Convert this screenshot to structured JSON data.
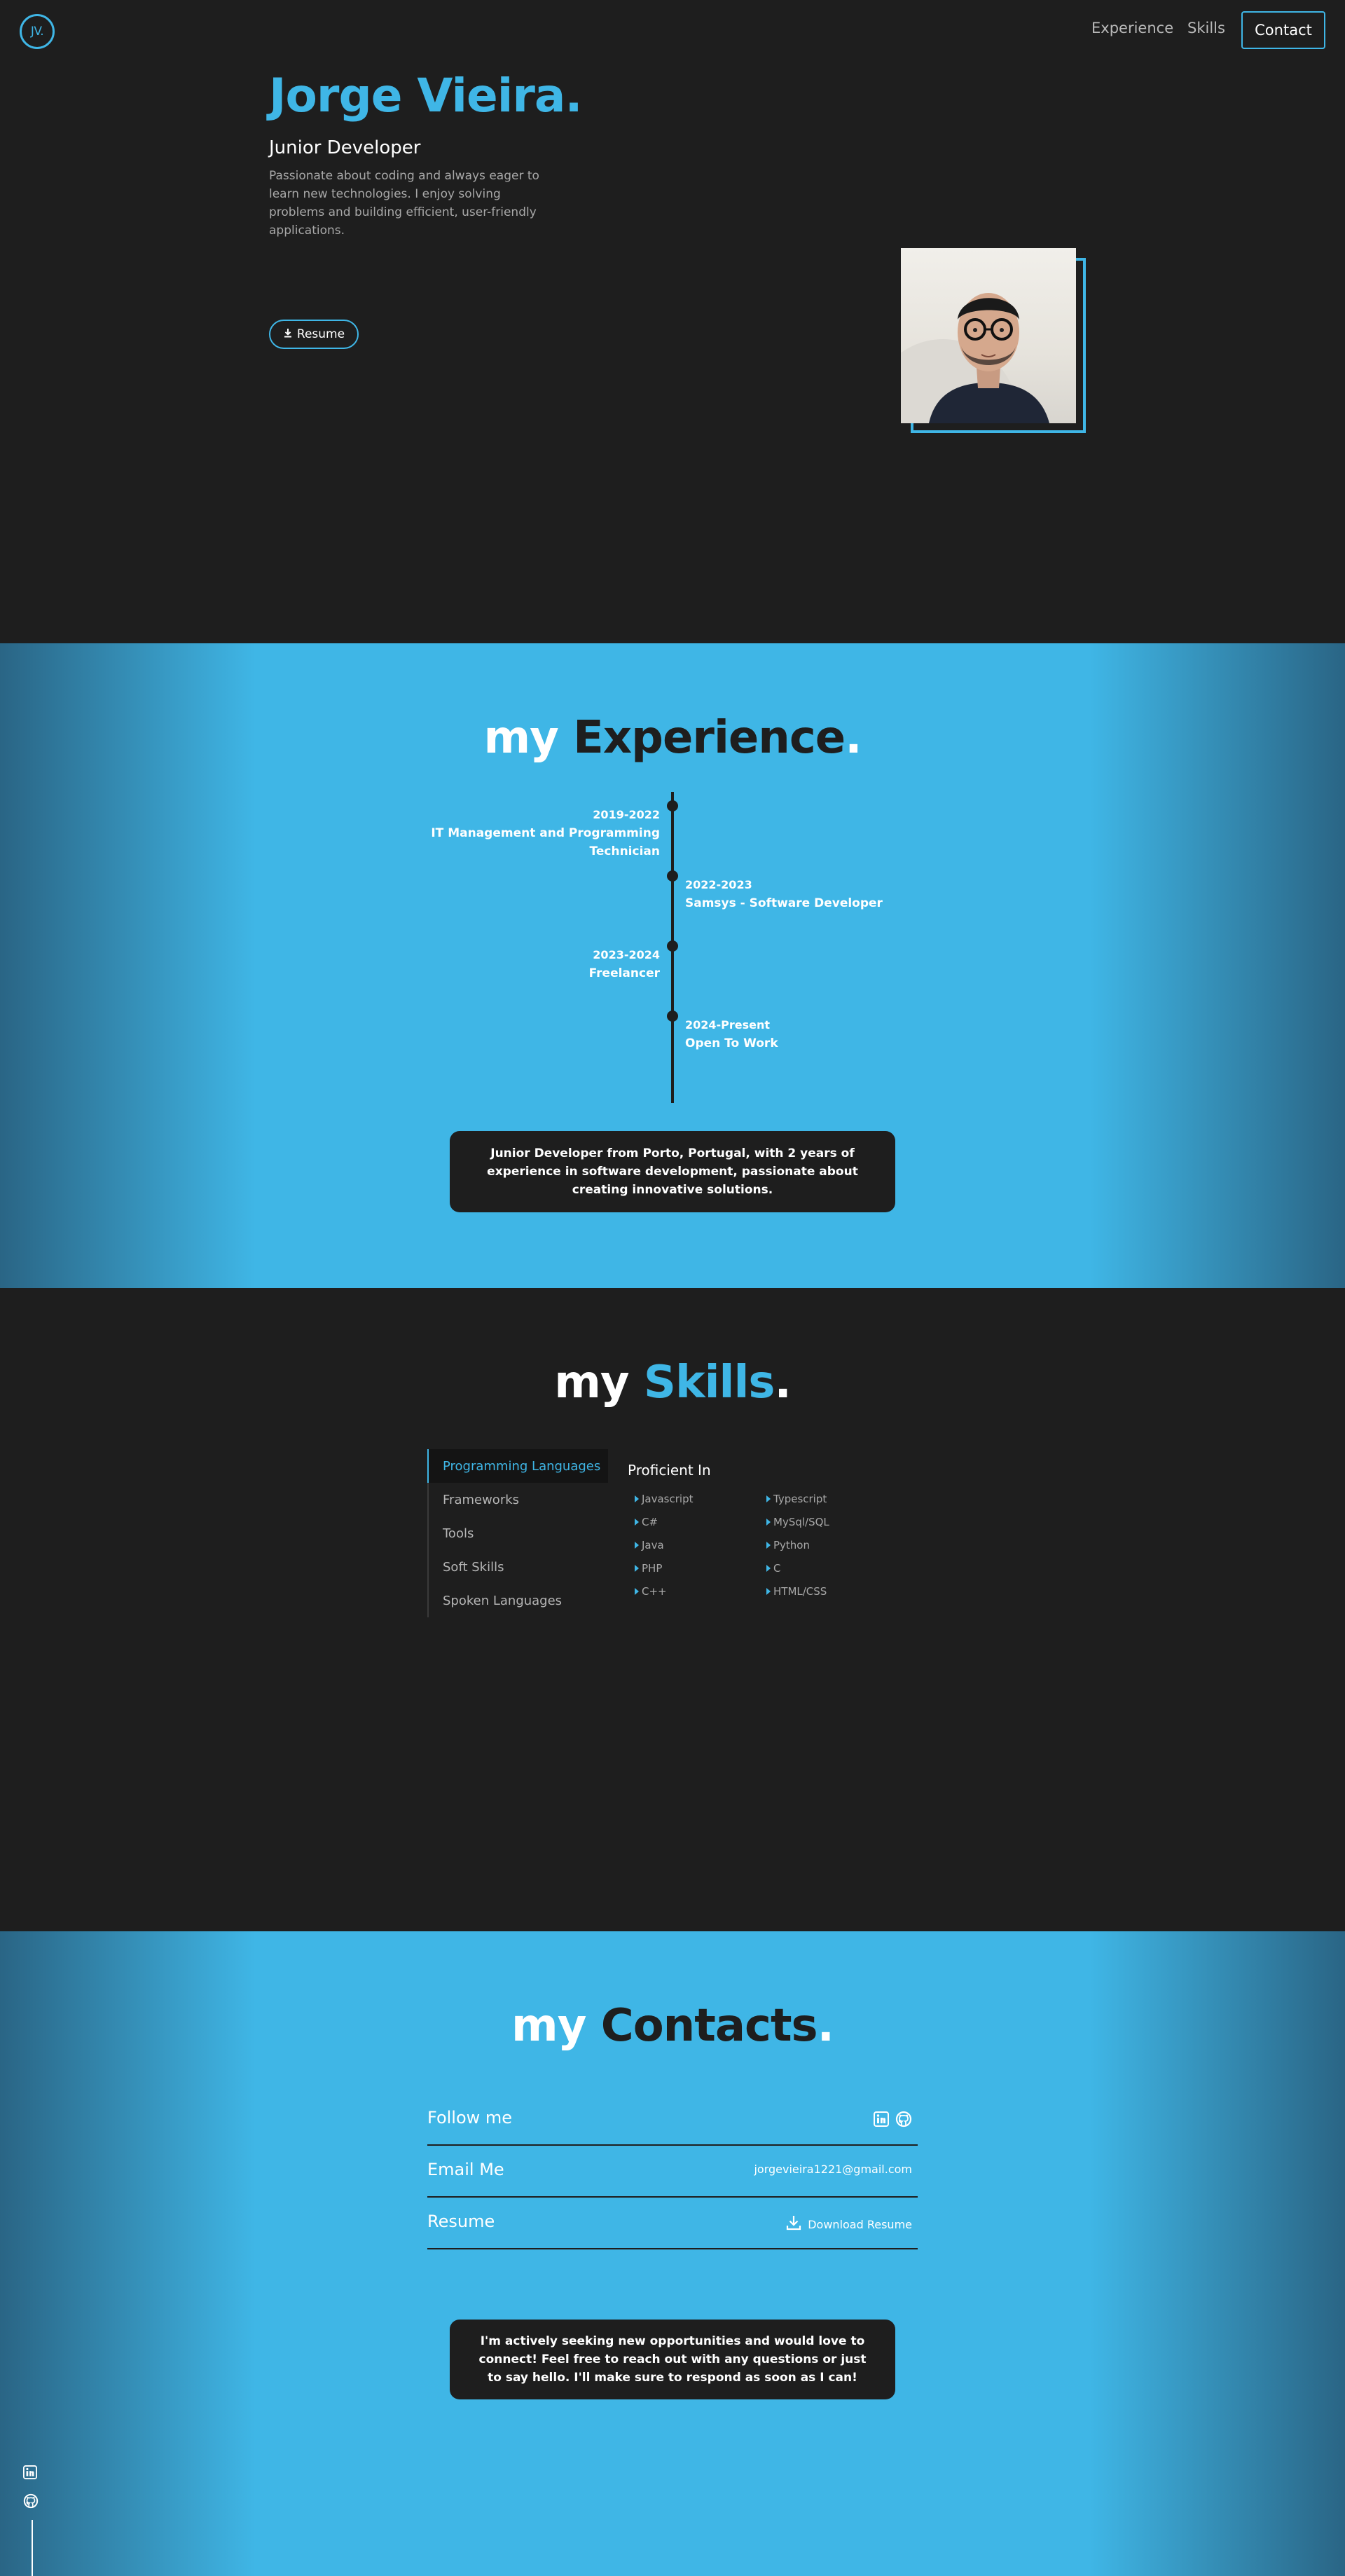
{
  "nav": {
    "logo": "JV.",
    "links": [
      "Experience",
      "Skills"
    ],
    "contact_label": "Contact"
  },
  "hero": {
    "name": "Jorge Vieira.",
    "role": "Junior Developer",
    "description": "Passionate about coding and always eager to learn new technologies. I enjoy solving problems and building efficient, user-friendly applications.",
    "resume_label": "Resume"
  },
  "experience": {
    "title_prefix": "my ",
    "title_word": "Experience",
    "title_dot": ".",
    "items": [
      {
        "date": "2019-2022",
        "title": "IT Management and Programming Technician",
        "side": "left"
      },
      {
        "date": "2022-2023",
        "title": "Samsys - Software Developer",
        "side": "right"
      },
      {
        "date": "2023-2024",
        "title": "Freelancer",
        "side": "left"
      },
      {
        "date": "2024-Present",
        "title": "Open To Work",
        "side": "right"
      }
    ],
    "summary": "Junior Developer from Porto, Portugal, with 2 years of experience in software development, passionate about creating innovative solutions."
  },
  "skills": {
    "title_prefix": "my ",
    "title_word": "Skills",
    "title_dot": ".",
    "tabs": [
      "Programming Languages",
      "Frameworks",
      "Tools",
      "Soft Skills",
      "Spoken Languages"
    ],
    "active_tab": "Programming Languages",
    "heading": "Proficient In",
    "items": [
      "Javascript",
      "Typescript",
      "C#",
      "MySql/SQL",
      "Java",
      "Python",
      "PHP",
      "C",
      "C++",
      "HTML/CSS"
    ]
  },
  "contacts": {
    "title_prefix": "my ",
    "title_word": "Contacts",
    "title_dot": ".",
    "rows": [
      {
        "label": "Follow me",
        "value": ""
      },
      {
        "label": "Email Me",
        "value": "jorgevieira1221@gmail.com"
      },
      {
        "label": "Resume",
        "value": "Download Resume"
      }
    ],
    "message": "I'm actively seeking new opportunities and would love to connect! Feel free to reach out with any questions or just to say hello. I'll make sure to respond as soon as I can!"
  },
  "colors": {
    "accent": "#3fb6e6",
    "background": "#1e1e1e",
    "text_muted": "#a8a8a8"
  },
  "icons": [
    "linkedin-icon",
    "github-icon",
    "download-icon",
    "caret-right-icon"
  ]
}
